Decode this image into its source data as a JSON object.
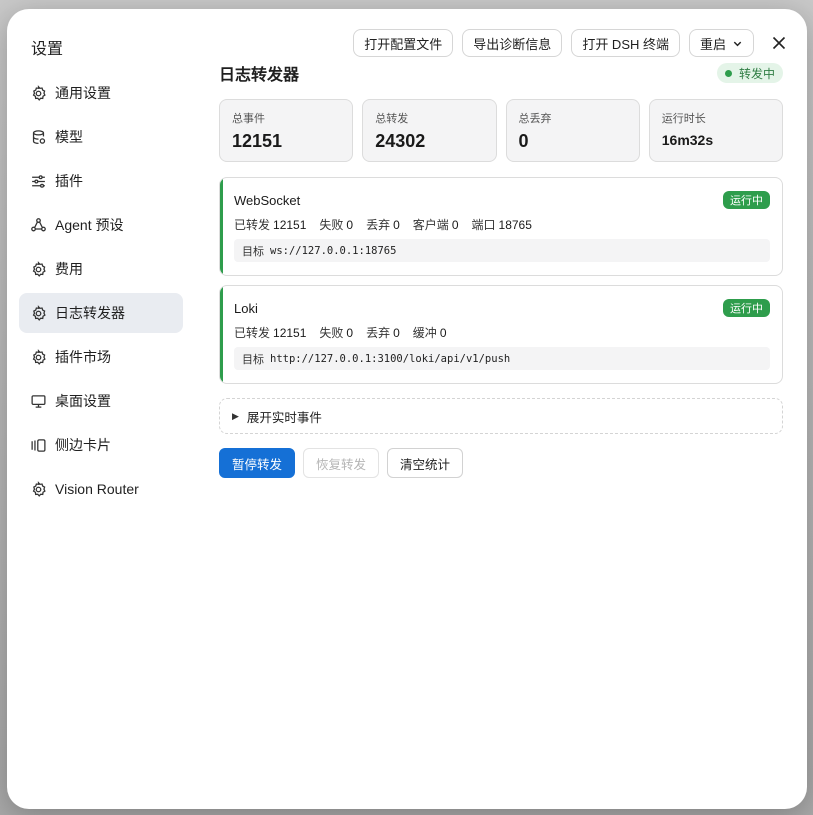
{
  "sidebar": {
    "title": "设置",
    "items": [
      {
        "label": "通用设置",
        "icon": "gear-icon"
      },
      {
        "label": "模型",
        "icon": "database-icon"
      },
      {
        "label": "插件",
        "icon": "sliders-icon"
      },
      {
        "label": "Agent 预设",
        "icon": "agent-icon"
      },
      {
        "label": "费用",
        "icon": "gear-icon"
      },
      {
        "label": "日志转发器",
        "icon": "gear-icon",
        "active": true
      },
      {
        "label": "插件市场",
        "icon": "gear-icon"
      },
      {
        "label": "桌面设置",
        "icon": "monitor-icon"
      },
      {
        "label": "侧边卡片",
        "icon": "cards-icon"
      },
      {
        "label": "Vision Router",
        "icon": "gear-icon"
      }
    ]
  },
  "toolbar": {
    "open_config": "打开配置文件",
    "export_diag": "导出诊断信息",
    "open_terminal": "打开 DSH 终端",
    "restart": "重启"
  },
  "main": {
    "title": "日志转发器",
    "status": "转发中",
    "stats": [
      {
        "label": "总事件",
        "value": "12151"
      },
      {
        "label": "总转发",
        "value": "24302"
      },
      {
        "label": "总丢弃",
        "value": "0"
      },
      {
        "label": "运行时长",
        "value": "16m32s"
      }
    ],
    "forwarders": [
      {
        "name": "WebSocket",
        "badge": "运行中",
        "stats": [
          {
            "label": "已转发",
            "value": "12151"
          },
          {
            "label": "失败",
            "value": "0"
          },
          {
            "label": "丢弃",
            "value": "0"
          },
          {
            "label": "客户端",
            "value": "0"
          },
          {
            "label": "端口",
            "value": "18765"
          }
        ],
        "target_label": "目标",
        "target": "ws://127.0.0.1:18765"
      },
      {
        "name": "Loki",
        "badge": "运行中",
        "stats": [
          {
            "label": "已转发",
            "value": "12151"
          },
          {
            "label": "失败",
            "value": "0"
          },
          {
            "label": "丢弃",
            "value": "0"
          },
          {
            "label": "缓冲",
            "value": "0"
          }
        ],
        "target_label": "目标",
        "target": "http://127.0.0.1:3100/loki/api/v1/push"
      }
    ],
    "expander": "展开实时事件",
    "actions": {
      "pause": "暂停转发",
      "resume": "恢复转发",
      "clear": "清空统计"
    }
  },
  "colors": {
    "accent": "#1570d6",
    "running": "#2e9d4c",
    "active_nav_bg": "#e9ecf1"
  }
}
